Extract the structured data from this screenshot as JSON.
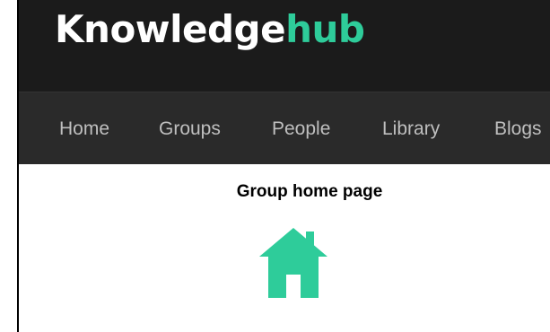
{
  "header": {
    "logo_main": "Knowledge",
    "logo_accent": "hub",
    "accent_color": "#2ecc9a"
  },
  "nav": {
    "items": [
      {
        "label": "Home"
      },
      {
        "label": "Groups"
      },
      {
        "label": "People"
      },
      {
        "label": "Library"
      },
      {
        "label": "Blogs"
      }
    ]
  },
  "main": {
    "title": "Group home page",
    "icon": "home-icon"
  }
}
